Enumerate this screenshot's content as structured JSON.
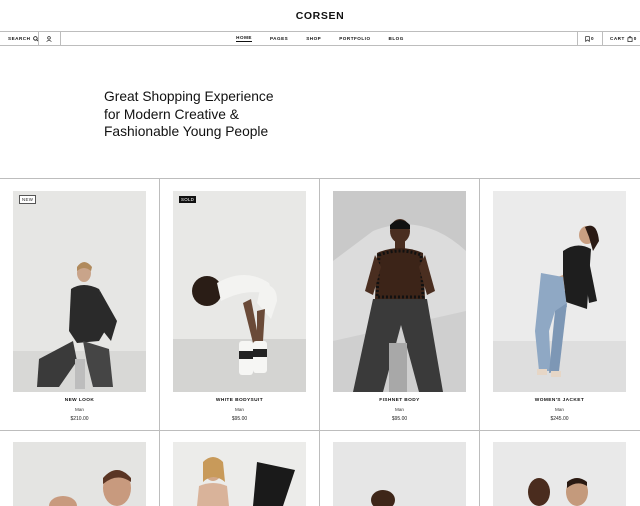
{
  "brand": {
    "logo": "CORSEN"
  },
  "nav": {
    "search_label": "SEARCH",
    "links": [
      "HOME",
      "PAGES",
      "SHOP",
      "PORTFOLIO",
      "BLOG"
    ],
    "wishlist_count": "0",
    "cart_label": "CART",
    "cart_count": "0"
  },
  "hero": {
    "line1": "Great Shopping Experience",
    "line2": "for Modern Creative &",
    "line3": "Fashionable Young People"
  },
  "products": [
    {
      "name": "NEW LOOK",
      "category": "Man",
      "price": "$210.00",
      "badge": "NEW"
    },
    {
      "name": "WHITE BODYSUIT",
      "category": "Man",
      "price": "$95.00"
    },
    {
      "name": "FISHNET BODY",
      "category": "Man",
      "price": "$95.00"
    },
    {
      "name": "WOMEN'S JACKET",
      "category": "Man",
      "price": "$245.00"
    }
  ],
  "second_row": {
    "badge": "SOLD"
  },
  "colors": {
    "accent": "#111111",
    "border": "#bdbdbd",
    "photo_bg": "#e9e9e9"
  }
}
